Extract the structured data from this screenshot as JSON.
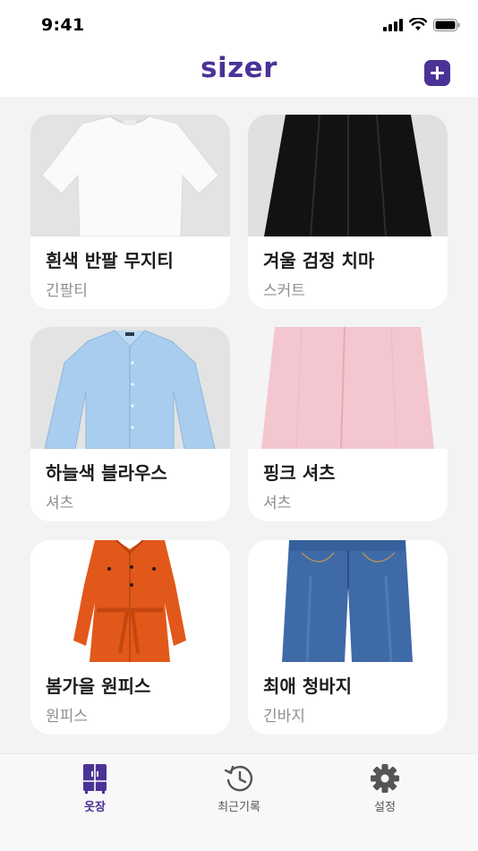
{
  "status_bar": {
    "time": "9:41"
  },
  "header": {
    "logo_text": "sizer",
    "add_label": "+"
  },
  "colors": {
    "brand": "#4b3296",
    "card_bg": "#ffffff",
    "page_bg": "#f3f3f3"
  },
  "items": [
    {
      "name": "흰색 반팔 무지티",
      "category": "긴팔티",
      "image": "white-tshirt"
    },
    {
      "name": "겨울 검정 치마",
      "category": "스커트",
      "image": "black-skirt"
    },
    {
      "name": "하늘색 블라우스",
      "category": "셔츠",
      "image": "light-blue-shirt"
    },
    {
      "name": "핑크 셔츠",
      "category": "셔츠",
      "image": "pink-shirt"
    },
    {
      "name": "봄가을 원피스",
      "category": "원피스",
      "image": "orange-dress"
    },
    {
      "name": "최애 청바지",
      "category": "긴바지",
      "image": "blue-jeans"
    }
  ],
  "tabs": [
    {
      "label": "옷장",
      "icon": "closet-icon",
      "active": true
    },
    {
      "label": "최근기록",
      "icon": "history-icon",
      "active": false
    },
    {
      "label": "설정",
      "icon": "gear-icon",
      "active": false
    }
  ]
}
